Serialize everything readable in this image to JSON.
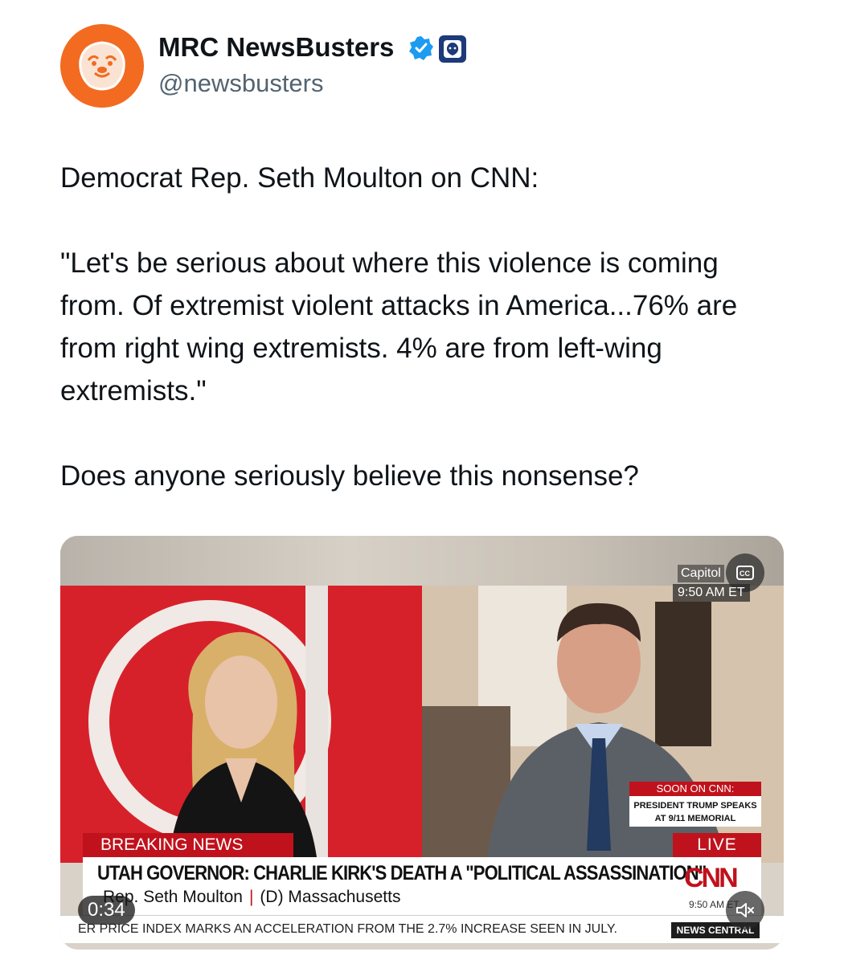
{
  "author": {
    "display_name": "MRC NewsBusters",
    "handle": "@newsbusters",
    "avatar_icon": "bulldog-logo-icon",
    "verified_icon": "verified-badge-icon",
    "affiliate_icon": "affiliate-badge-icon"
  },
  "tweet": {
    "line1": "Democrat Rep. Seth Moulton on CNN:",
    "quote": "\"Let's be serious about where this violence is coming from. Of extremist violent attacks in America...76% are from right wing extremists. 4% are from left-wing extremists.\"",
    "line3": "Does anyone seriously believe this nonsense?"
  },
  "video": {
    "location_label": "Capitol",
    "time_label": "9:50 AM ET",
    "soon_heading": "SOON ON CNN:",
    "soon_body": "PRESIDENT TRUMP SPEAKS AT 9/11 MEMORIAL",
    "breaking_label": "BREAKING NEWS",
    "live_label": "LIVE",
    "headline": "UTAH GOVERNOR: CHARLIE KIRK'S DEATH A \"POLITICAL ASSASSINATION\"",
    "network": "CNN",
    "guest_name": "Rep. Seth Moulton",
    "guest_party": "(D) Massachusetts",
    "corner_time": "9:50 AM ET",
    "ticker": "ER PRICE INDEX MARKS AN ACCELERATION FROM THE 2.7% INCREASE SEEN IN JULY.",
    "ticker_brand": "NEWS CENTRAL",
    "elapsed": "0:34"
  },
  "colors": {
    "avatar_bg": "#f26b21",
    "verified_blue": "#1d9bf0",
    "cnn_red": "#c0121c",
    "handle_gray": "#536471"
  }
}
